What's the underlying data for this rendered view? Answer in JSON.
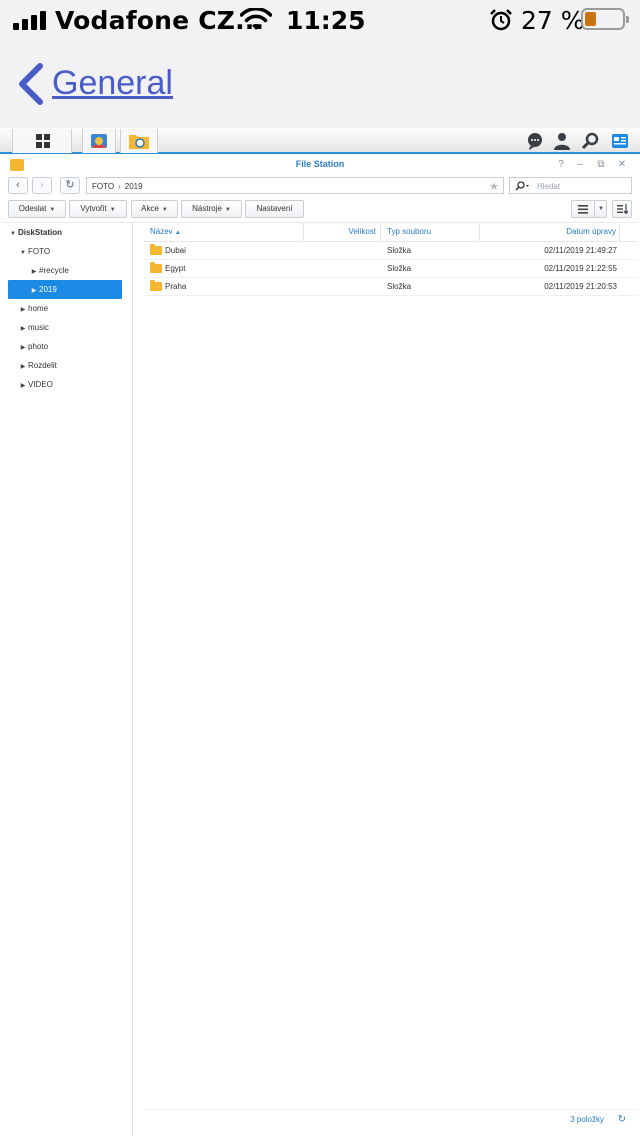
{
  "status_bar": {
    "carrier": "Vodafone CZ...",
    "time": "11:25",
    "battery_percent": "27 %",
    "battery_level": 0.27,
    "icons": [
      "signal-icon",
      "wifi-icon",
      "alarm-icon",
      "battery-icon"
    ]
  },
  "nav": {
    "back_label": "General"
  },
  "taskbar": {
    "left_icons": [
      "main-menu-icon",
      "control-panel-icon",
      "file-station-icon"
    ],
    "right_icons": [
      "chat-icon",
      "user-icon",
      "search-icon",
      "widgets-icon"
    ]
  },
  "window": {
    "title": "File Station",
    "controls": [
      "help-icon",
      "minimize-icon",
      "restore-icon",
      "close-icon"
    ],
    "path": [
      "FOTO",
      "2019"
    ],
    "search_placeholder": "Hledat",
    "toolbar": [
      {
        "label": "Odeslat",
        "dropdown": true
      },
      {
        "label": "Vytvořit",
        "dropdown": true
      },
      {
        "label": "Akce",
        "dropdown": true
      },
      {
        "label": "Nástroje",
        "dropdown": true
      },
      {
        "label": "Nastavení",
        "dropdown": false
      }
    ],
    "tree": [
      {
        "label": "DiskStation",
        "expanded": true,
        "root": true
      },
      {
        "label": "FOTO",
        "expanded": true
      },
      {
        "label": "#recycle",
        "expanded": false
      },
      {
        "label": "2019",
        "expanded": false,
        "selected": true
      },
      {
        "label": "home",
        "expanded": false
      },
      {
        "label": "music",
        "expanded": false
      },
      {
        "label": "photo",
        "expanded": false
      },
      {
        "label": "Rozdelit",
        "expanded": false
      },
      {
        "label": "VIDEO",
        "expanded": false
      }
    ],
    "columns": {
      "name": "Název",
      "size": "Velikost",
      "type": "Typ souboru",
      "modified": "Datum úpravy"
    },
    "files": [
      {
        "name": "Dubai",
        "size": "",
        "type": "Složka",
        "modified": "02/11/2019 21:49:27"
      },
      {
        "name": "Egypt",
        "size": "",
        "type": "Složka",
        "modified": "02/11/2019 21:22:55"
      },
      {
        "name": "Praha",
        "size": "",
        "type": "Složka",
        "modified": "02/11/2019 21:20:53"
      }
    ],
    "item_count": "3 položky"
  },
  "colors": {
    "accent": "#1a8ae4",
    "link": "#4a5cc8",
    "folder": "#f5b731"
  }
}
